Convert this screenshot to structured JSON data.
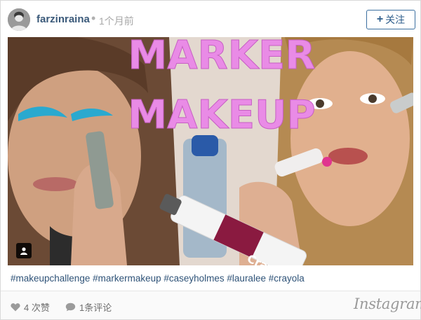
{
  "post": {
    "username": "farzinraina",
    "separator": "•",
    "time_ago": "1个月前",
    "follow_plus": "+",
    "follow_label": "关注",
    "caption": "#makeupchallenge #markermakeup #caseyholmes #lauralee #crayola"
  },
  "image": {
    "title_line1": "MARKER",
    "title_line2": "MAKEUP",
    "title_color": "#e98be6",
    "marker_brand": "Crayola",
    "marker_sub": "MARKER"
  },
  "footer": {
    "likes_label": "4 次赞",
    "comments_label": "1条评论",
    "brand": "Instagram"
  },
  "icons": [
    "user-avatar",
    "heart-icon",
    "comment-icon",
    "user-tag-icon"
  ]
}
